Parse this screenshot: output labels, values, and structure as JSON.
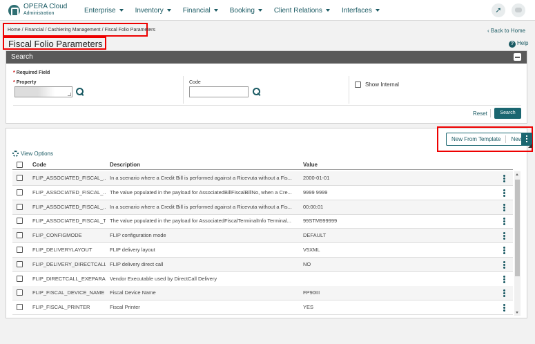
{
  "app": {
    "title": "OPERA Cloud",
    "subtitle": "Administration"
  },
  "nav": [
    {
      "label": "Enterprise"
    },
    {
      "label": "Inventory"
    },
    {
      "label": "Financial"
    },
    {
      "label": "Booking"
    },
    {
      "label": "Client Relations"
    },
    {
      "label": "Interfaces"
    }
  ],
  "breadcrumb": "Home / Financial / Cashiering Management / Fiscal Folio Parameters",
  "back_link": "Back to Home",
  "page_title": "Fiscal Folio Parameters",
  "help": "Help",
  "search": {
    "title": "Search",
    "required_label": "Required Field",
    "property_label": "Property",
    "property_value": "",
    "code_label": "Code",
    "code_value": "",
    "show_internal_label": "Show Internal",
    "reset_label": "Reset",
    "search_label": "Search"
  },
  "results": {
    "new_from_template_label": "New From Template",
    "new_label": "New",
    "view_options_label": "View Options",
    "columns": {
      "code": "Code",
      "description": "Description",
      "value": "Value"
    },
    "rows": [
      {
        "code": "FLIP_ASSOCIATED_FISCAL_...",
        "description": "In a scenario where a Credit Bill is performed against a Ricevuta without a Fis...",
        "value": "2000-01-01"
      },
      {
        "code": "FLIP_ASSOCIATED_FISCAL_...",
        "description": "The value populated in the payload for AssociatedBillFiscalBillNo, when a Cre...",
        "value": "9999 9999"
      },
      {
        "code": "FLIP_ASSOCIATED_FISCAL_...",
        "description": "In a scenario where a Credit Bill is performed against a Ricevuta without a Fis...",
        "value": "00:00:01"
      },
      {
        "code": "FLIP_ASSOCIATED_FISCAL_T...",
        "description": "The value populated in the payload for AssociatedFiscalTerminalInfo Terminal...",
        "value": "99STM999999"
      },
      {
        "code": "FLIP_CONFIGMODE",
        "description": "FLIP configuration mode",
        "value": "DEFAULT"
      },
      {
        "code": "FLIP_DELIVERYLAYOUT",
        "description": "FLIP delivery layout",
        "value": "V5XML"
      },
      {
        "code": "FLIP_DELIVERY_DIRECTCALL",
        "description": "FLIP delivery direct call",
        "value": "NO"
      },
      {
        "code": "FLIP_DIRECTCALL_EXEPARAM",
        "description": "Vendor Executable used by DirectCall Delivery",
        "value": ""
      },
      {
        "code": "FLIP_FISCAL_DEVICE_NAME",
        "description": "Fiscal Device Name",
        "value": "FP90III"
      },
      {
        "code": "FLIP_FISCAL_PRINTER",
        "description": "Fiscal Printer",
        "value": "YES"
      }
    ]
  },
  "icons": {
    "rocket": "rocket-icon",
    "chat": "chat-icon",
    "back": "chevron-left-icon",
    "help": "help-icon",
    "search": "search-icon",
    "gear": "gear-icon",
    "kebab": "kebab-icon"
  },
  "colors": {
    "accent": "#1a6670",
    "highlight": "#ee0000",
    "header_bar": "#595959"
  }
}
